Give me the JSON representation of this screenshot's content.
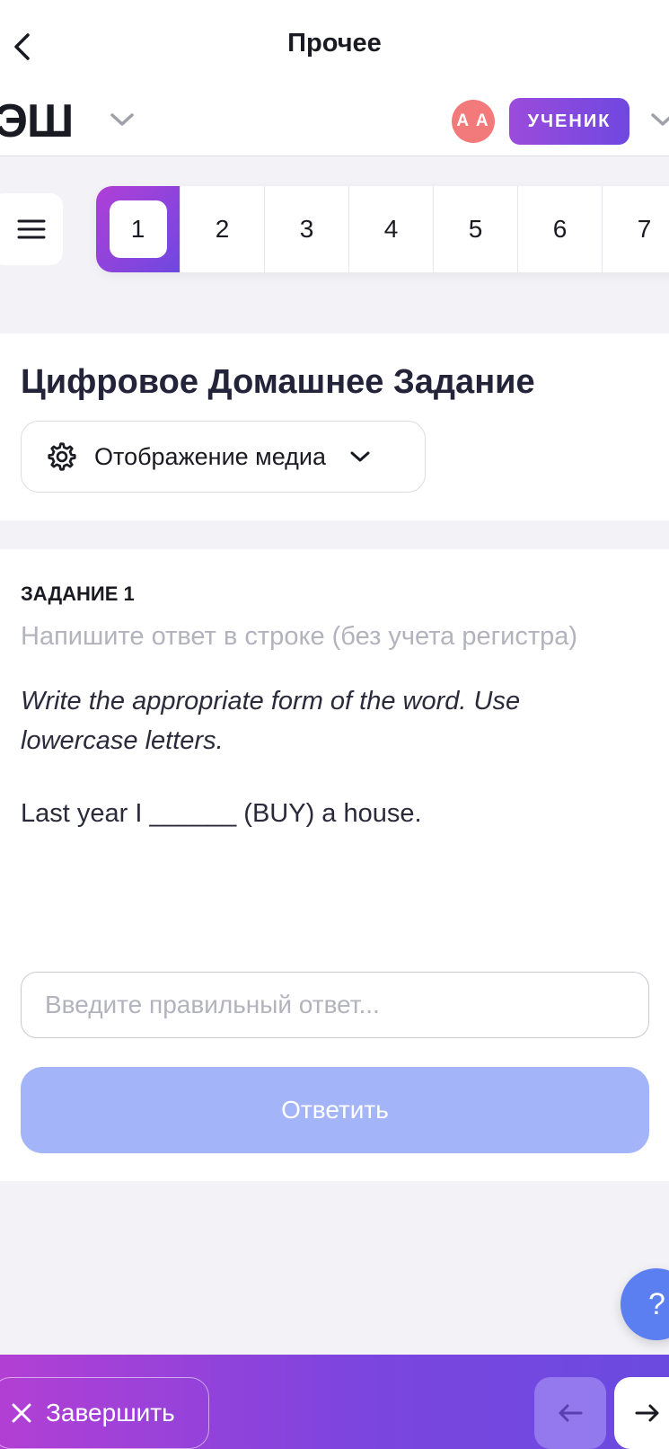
{
  "header": {
    "title": "Прочее"
  },
  "appbar": {
    "logo_text": "ЭШ",
    "avatar_initials": "A A",
    "role_badge": "УЧЕНИК"
  },
  "question_nav": {
    "items": [
      "1",
      "2",
      "3",
      "4",
      "5",
      "6",
      "7"
    ],
    "active": "1"
  },
  "homework": {
    "title": "Цифровое Домашнее Задание",
    "media_toggle_label": "Отображение медиа"
  },
  "task": {
    "number_label": "ЗАДАНИЕ 1",
    "hint": "Напишите ответ в строке (без учета регистра)",
    "instruction": "Write the appropriate form of the word. Use lowercase letters.",
    "sentence": "Last year I ______ (BUY) a house.",
    "answer_placeholder": "Введите правильный ответ...",
    "submit_label": "Ответить"
  },
  "help": {
    "label": "?"
  },
  "footer": {
    "finish_label": "Завершить"
  },
  "colors": {
    "accent_start": "#b03fd6",
    "accent_end": "#6f48e0",
    "submit_disabled": "#a4b4f8",
    "avatar": "#f27a7a",
    "help": "#5b7ff0"
  },
  "icons": {
    "back": "chevron-left-icon",
    "menu": "hamburger-icon",
    "settings": "gear-icon",
    "dropdown": "chevron-down-icon",
    "close": "close-icon",
    "prev": "arrow-left-icon",
    "next": "arrow-right-icon"
  }
}
